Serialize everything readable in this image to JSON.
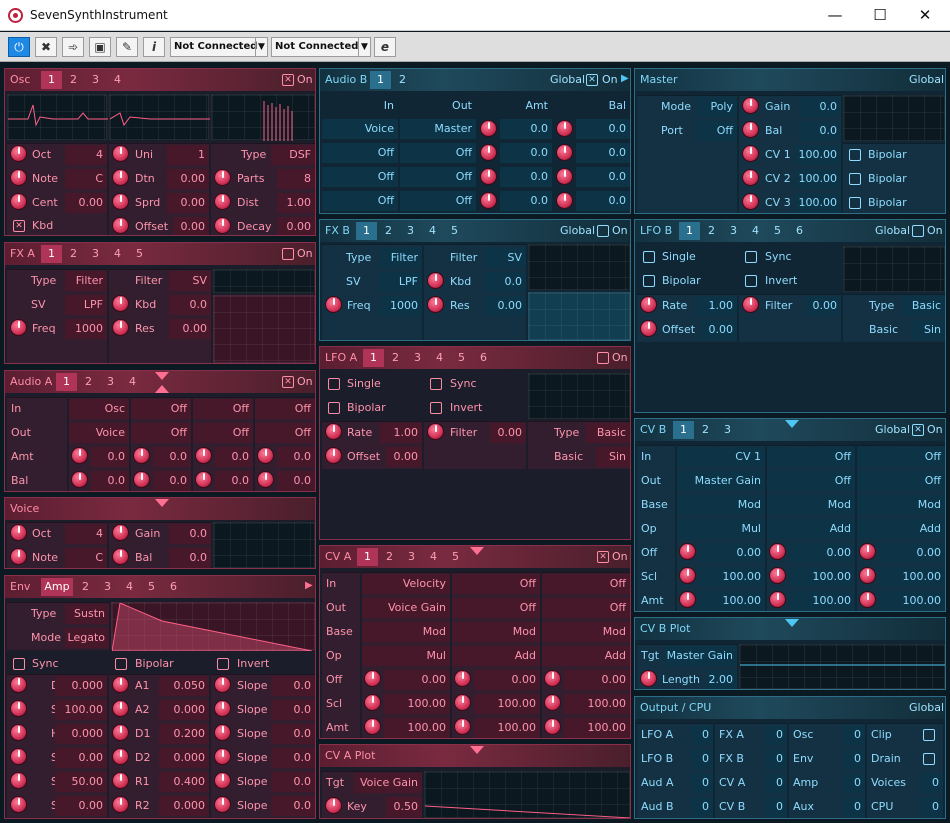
{
  "window": {
    "title": "SevenSynthInstrument",
    "min_glyph": "—",
    "max_glyph": "☐",
    "close_glyph": "✕"
  },
  "toolbar": {
    "info_label": "i",
    "edit_label": "e",
    "midi_in": "Not Connected",
    "midi_out": "Not Connected"
  },
  "osc": {
    "title": "Osc",
    "tabs": [
      "1",
      "2",
      "3",
      "4"
    ],
    "on": "On",
    "check": "✕",
    "c1": [
      {
        "l": "Oct",
        "v": "4"
      },
      {
        "l": "Note",
        "v": "C"
      },
      {
        "l": "Cent",
        "v": "0.00"
      },
      {
        "l": "Kbd",
        "v": ""
      }
    ],
    "c2": [
      {
        "l": "Uni",
        "v": "1"
      },
      {
        "l": "Dtn",
        "v": "0.00"
      },
      {
        "l": "Sprd",
        "v": "0.00"
      },
      {
        "l": "Offset",
        "v": "0.00"
      }
    ],
    "c3": [
      {
        "l": "Type",
        "v": "DSF"
      },
      {
        "l": "Parts",
        "v": "8"
      },
      {
        "l": "Dist",
        "v": "1.00"
      },
      {
        "l": "Decay",
        "v": "0.00"
      }
    ]
  },
  "fxa": {
    "title": "FX A",
    "tabs": [
      "1",
      "2",
      "3",
      "4",
      "5"
    ],
    "on": "On",
    "c1": [
      {
        "l": "Type",
        "v": "Filter"
      },
      {
        "l": "SV",
        "v": "LPF"
      },
      {
        "l": "Freq",
        "v": "1000"
      }
    ],
    "c2": [
      {
        "l": "Filter",
        "v": "SV"
      },
      {
        "l": "Kbd",
        "v": "0.0"
      },
      {
        "l": "Res",
        "v": "0.00"
      }
    ]
  },
  "audioa": {
    "title": "Audio A",
    "tabs": [
      "1",
      "2",
      "3",
      "4"
    ],
    "on": "On",
    "check": "✕",
    "rows": [
      "In",
      "Out",
      "Amt",
      "Bal"
    ],
    "cols": [
      [
        "Osc",
        "Voice",
        "0.0",
        "0.0"
      ],
      [
        "Off",
        "Off",
        "0.0",
        "0.0"
      ],
      [
        "Off",
        "Off",
        "0.0",
        "0.0"
      ],
      [
        "Off",
        "Off",
        "0.0",
        "0.0"
      ]
    ]
  },
  "voice": {
    "title": "Voice",
    "c1": [
      {
        "l": "Oct",
        "v": "4"
      },
      {
        "l": "Note",
        "v": "C"
      }
    ],
    "c2": [
      {
        "l": "Gain",
        "v": "0.0"
      },
      {
        "l": "Bal",
        "v": "0.0"
      }
    ]
  },
  "env": {
    "title": "Env",
    "tabs": [
      "Amp",
      "2",
      "3",
      "4",
      "5",
      "6"
    ],
    "type": {
      "l": "Type",
      "v": "Sustn"
    },
    "mode": {
      "l": "Mode",
      "v": "Legato"
    },
    "checks": [
      "Sync",
      "Bipolar",
      "Invert"
    ],
    "c1": [
      {
        "l": "Delay",
        "v": "0.000"
      },
      {
        "l": "Split",
        "v": "100.00"
      },
      {
        "l": "Hold",
        "v": "0.000"
      },
      {
        "l": "Split",
        "v": "0.00"
      },
      {
        "l": "Sustn",
        "v": "50.00"
      },
      {
        "l": "Split",
        "v": "0.00"
      }
    ],
    "c2": [
      {
        "l": "A1",
        "v": "0.050"
      },
      {
        "l": "A2",
        "v": "0.000"
      },
      {
        "l": "D1",
        "v": "0.200"
      },
      {
        "l": "D2",
        "v": "0.000"
      },
      {
        "l": "R1",
        "v": "0.400"
      },
      {
        "l": "R2",
        "v": "0.000"
      }
    ],
    "c3": [
      {
        "l": "Slope",
        "v": "0.0"
      },
      {
        "l": "Slope",
        "v": "0.0"
      },
      {
        "l": "Slope",
        "v": "0.0"
      },
      {
        "l": "Slope",
        "v": "0.0"
      },
      {
        "l": "Slope",
        "v": "0.0"
      },
      {
        "l": "Slope",
        "v": "0.0"
      }
    ]
  },
  "audiob": {
    "title": "Audio B",
    "tabs": [
      "1",
      "2"
    ],
    "global": "Global",
    "on": "On",
    "check": "✕",
    "headers": [
      "In",
      "Out",
      "Amt",
      "Bal"
    ],
    "rows": [
      [
        "Voice",
        "Master",
        "0.0",
        "0.0"
      ],
      [
        "Off",
        "Off",
        "0.0",
        "0.0"
      ],
      [
        "Off",
        "Off",
        "0.0",
        "0.0"
      ],
      [
        "Off",
        "Off",
        "0.0",
        "0.0"
      ]
    ]
  },
  "fxb": {
    "title": "FX B",
    "tabs": [
      "1",
      "2",
      "3",
      "4",
      "5"
    ],
    "global": "Global",
    "on": "On",
    "c1": [
      {
        "l": "Type",
        "v": "Filter"
      },
      {
        "l": "SV",
        "v": "LPF"
      },
      {
        "l": "Freq",
        "v": "1000"
      }
    ],
    "c2": [
      {
        "l": "Filter",
        "v": "SV"
      },
      {
        "l": "Kbd",
        "v": "0.0"
      },
      {
        "l": "Res",
        "v": "0.00"
      }
    ]
  },
  "lfoa": {
    "title": "LFO A",
    "tabs": [
      "1",
      "2",
      "3",
      "4",
      "5",
      "6"
    ],
    "on": "On",
    "checks": [
      "Single",
      "Sync",
      "Bipolar",
      "Invert"
    ],
    "rate": {
      "l": "Rate",
      "v": "1.00"
    },
    "filter": {
      "l": "Filter",
      "v": "0.00"
    },
    "offset": {
      "l": "Offset",
      "v": "0.00"
    },
    "type": {
      "l": "Type",
      "v": "Basic"
    },
    "basic": {
      "l": "Basic",
      "v": "Sin"
    }
  },
  "cva": {
    "title": "CV A",
    "tabs": [
      "1",
      "2",
      "3",
      "4",
      "5"
    ],
    "on": "On",
    "check": "✕",
    "rows": [
      "In",
      "Out",
      "Base",
      "Op",
      "Off",
      "Scl",
      "Amt"
    ],
    "cols": [
      [
        "Velocity",
        "Voice Gain",
        "Mod",
        "Mul",
        "0.00",
        "100.00",
        "100.00"
      ],
      [
        "Off",
        "Off",
        "Mod",
        "Add",
        "0.00",
        "100.00",
        "100.00"
      ],
      [
        "Off",
        "Off",
        "Mod",
        "Add",
        "0.00",
        "100.00",
        "100.00"
      ]
    ]
  },
  "cvaplot": {
    "title": "CV A Plot",
    "tgt": {
      "l": "Tgt",
      "v": "Voice Gain"
    },
    "key": {
      "l": "Key",
      "v": "0.50"
    }
  },
  "master": {
    "title": "Master",
    "global": "Global",
    "mode": {
      "l": "Mode",
      "v": "Poly"
    },
    "port": {
      "l": "Port",
      "v": "Off"
    },
    "gain": {
      "l": "Gain",
      "v": "0.0"
    },
    "bal": {
      "l": "Bal",
      "v": "0.0"
    },
    "cvs": [
      {
        "l": "CV 1",
        "v": "100.00"
      },
      {
        "l": "CV 2",
        "v": "100.00"
      },
      {
        "l": "CV 3",
        "v": "100.00"
      }
    ],
    "bipolar": "Bipolar"
  },
  "lfob": {
    "title": "LFO B",
    "tabs": [
      "1",
      "2",
      "3",
      "4",
      "5",
      "6"
    ],
    "global": "Global",
    "on": "On",
    "checks": [
      "Single",
      "Sync",
      "Bipolar",
      "Invert"
    ],
    "rate": {
      "l": "Rate",
      "v": "1.00"
    },
    "filter": {
      "l": "Filter",
      "v": "0.00"
    },
    "offset": {
      "l": "Offset",
      "v": "0.00"
    },
    "type": {
      "l": "Type",
      "v": "Basic"
    },
    "basic": {
      "l": "Basic",
      "v": "Sin"
    }
  },
  "cvb": {
    "title": "CV B",
    "tabs": [
      "1",
      "2",
      "3"
    ],
    "global": "Global",
    "on": "On",
    "check": "✕",
    "rows": [
      "In",
      "Out",
      "Base",
      "Op",
      "Off",
      "Scl",
      "Amt"
    ],
    "cols": [
      [
        "CV 1",
        "Master Gain",
        "Mod",
        "Mul",
        "0.00",
        "100.00",
        "100.00"
      ],
      [
        "Off",
        "Off",
        "Mod",
        "Add",
        "0.00",
        "100.00",
        "100.00"
      ],
      [
        "Off",
        "Off",
        "Mod",
        "Add",
        "0.00",
        "100.00",
        "100.00"
      ]
    ]
  },
  "cvbplot": {
    "title": "CV B Plot",
    "tgt": {
      "l": "Tgt",
      "v": "Master Gain"
    },
    "length": {
      "l": "Length",
      "v": "2.00"
    }
  },
  "output": {
    "title": "Output / CPU",
    "global": "Global",
    "c1": [
      {
        "l": "LFO A",
        "v": "0"
      },
      {
        "l": "LFO B",
        "v": "0"
      },
      {
        "l": "Aud A",
        "v": "0"
      },
      {
        "l": "Aud B",
        "v": "0"
      }
    ],
    "c2": [
      {
        "l": "FX A",
        "v": "0"
      },
      {
        "l": "FX B",
        "v": "0"
      },
      {
        "l": "CV A",
        "v": "0"
      },
      {
        "l": "CV B",
        "v": "0"
      }
    ],
    "c3": [
      {
        "l": "Osc",
        "v": "0"
      },
      {
        "l": "Env",
        "v": "0"
      },
      {
        "l": "Amp",
        "v": "0"
      },
      {
        "l": "Aux",
        "v": "0"
      }
    ],
    "c4": [
      {
        "l": "Clip",
        "v": ""
      },
      {
        "l": "Drain",
        "v": ""
      },
      {
        "l": "Voices",
        "v": "0"
      },
      {
        "l": "CPU",
        "v": "0"
      }
    ]
  }
}
